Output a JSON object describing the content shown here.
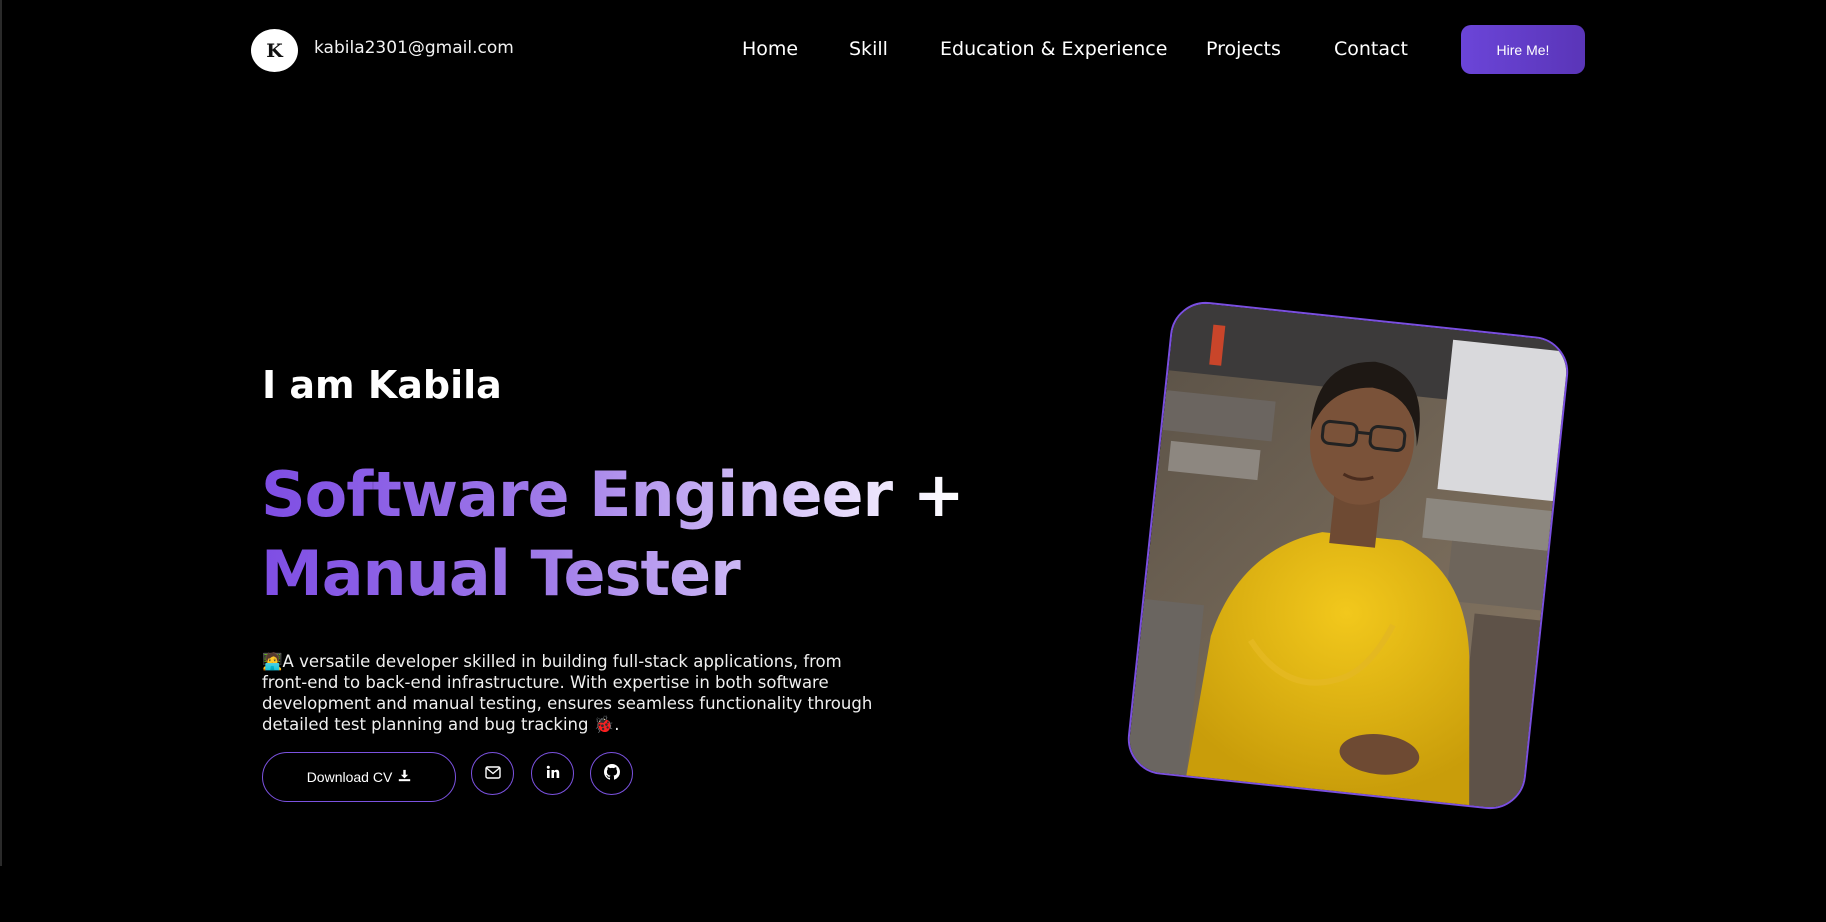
{
  "header": {
    "logo_letter": "K",
    "email": "kabila2301@gmail.com",
    "nav": [
      "Home",
      "Skill",
      "Education & Experience",
      "Projects",
      "Contact"
    ],
    "hire_button": "Hire Me!"
  },
  "hero": {
    "intro": "I am Kabila",
    "headline_line1": "Software Engineer +",
    "headline_line2": "Manual Tester",
    "description": "🧑‍💻A versatile developer skilled in building full-stack applications, from front-end to back-end infrastructure. With expertise in both software development and manual testing, ensures seamless functionality through detailed test planning and bug tracking 🐞.",
    "download_button": "Download CV",
    "social_icons": [
      "mail-icon",
      "linkedin-icon",
      "github-icon"
    ]
  },
  "colors": {
    "accent": "#7b52e0",
    "button_gradient_start": "#6b45d8",
    "background": "#000000"
  }
}
